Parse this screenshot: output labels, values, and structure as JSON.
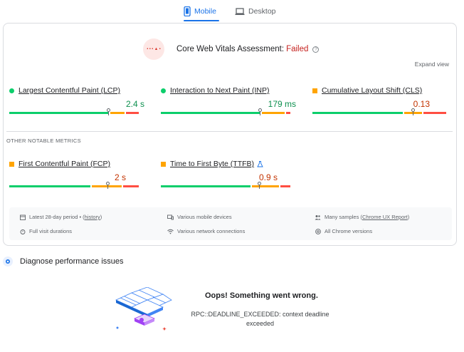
{
  "tabs": [
    {
      "label": "Mobile",
      "icon": "smartphone-icon",
      "active": true
    },
    {
      "label": "Desktop",
      "icon": "laptop-icon",
      "active": false
    }
  ],
  "assessment": {
    "logo_text": "• • • ▲ •",
    "title": "Core Web Vitals Assessment:",
    "status": "Failed",
    "status_color": "#c5221f"
  },
  "expand_view": "Expand view",
  "core_metrics": [
    {
      "name": "Largest Contentful Paint (LCP)",
      "value": "2.4 s",
      "rating": "good",
      "marker_pct": 74
    },
    {
      "name": "Interaction to Next Paint (INP)",
      "value": "179 ms",
      "rating": "good",
      "marker_pct": 74
    },
    {
      "name": "Cumulative Layout Shift (CLS)",
      "value": "0.13",
      "rating": "average",
      "marker_pct": 80
    }
  ],
  "other_label": "OTHER NOTABLE METRICS",
  "other_metrics": [
    {
      "name": "First Contentful Paint (FCP)",
      "value": "2 s",
      "rating": "average",
      "marker_pct": 75
    },
    {
      "name": "Time to First Byte (TTFB)",
      "value": "0.9 s",
      "rating": "average",
      "marker_pct": 74
    }
  ],
  "info": {
    "period_prefix": "Latest 28-day period • (",
    "period_link": "history",
    "period_suffix": ")",
    "devices": "Various mobile devices",
    "samples_prefix": "Many samples (",
    "samples_link": "Chrome UX Report",
    "samples_suffix": ")",
    "durations": "Full visit durations",
    "network": "Various network connections",
    "versions": "All Chrome versions"
  },
  "diagnose": {
    "title": "Diagnose performance issues"
  },
  "error": {
    "title": "Oops! Something went wrong.",
    "message": "RPC::DEADLINE_EXCEEDED: context deadline exceeded"
  },
  "colors": {
    "good": "#0cce6b",
    "average": "#ffa400",
    "poor": "#ff4e42",
    "accent": "#1a73e8"
  }
}
